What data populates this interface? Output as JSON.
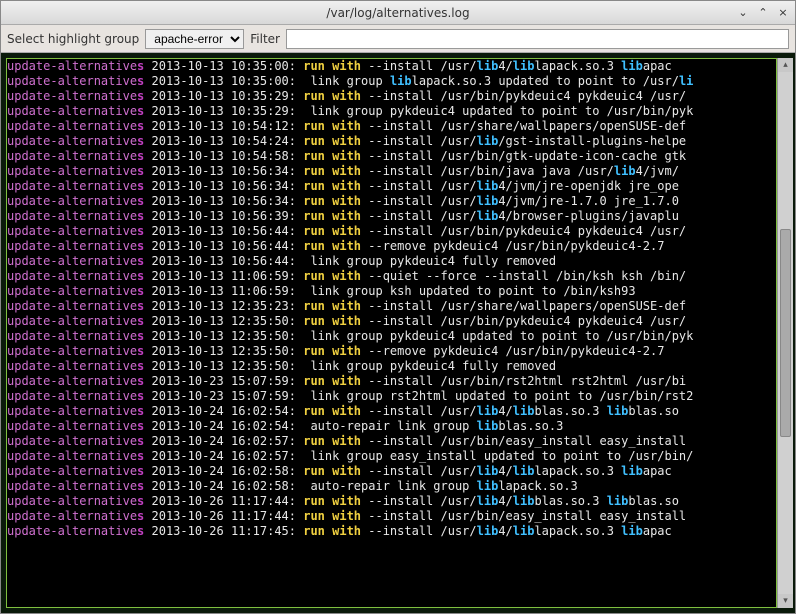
{
  "window": {
    "title": "/var/log/alternatives.log",
    "buttons": {
      "min": "⌄",
      "max": "⌃",
      "close": "×"
    }
  },
  "toolbar": {
    "highlight_label": "Select highlight group",
    "highlight_value": "apache-error",
    "filter_label": "Filter",
    "filter_value": ""
  },
  "colors": {
    "bg_terminal": "#000000",
    "border_terminal": "#7fbf3f",
    "purple": "#d070d0",
    "purple_bold": "#c040c0",
    "white": "#e8e8e8",
    "yellow": "#f0d040",
    "cyan": "#40c0ff"
  },
  "log_lines": [
    {
      "ts": "2013-10-13 10:35:00:",
      "action": "run with",
      "rest": " --install /usr/",
      "h": "lib",
      "r2": "4/",
      "h2": "lib",
      "r3": "lapack.so.3 ",
      "h3": "lib",
      "r4": "apac"
    },
    {
      "ts": "2013-10-13 10:35:00:",
      "action": "",
      "rest": " link group ",
      "h": "lib",
      "r2": "lapack.so.3 updated to point to /usr/",
      "h2": "li"
    },
    {
      "ts": "2013-10-13 10:35:29:",
      "action": "run with",
      "rest": " --install /usr/bin/pykdeuic4 pykdeuic4 /usr/"
    },
    {
      "ts": "2013-10-13 10:35:29:",
      "action": "",
      "rest": " link group pykdeuic4 updated to point to /usr/bin/pyk"
    },
    {
      "ts": "2013-10-13 10:54:12:",
      "action": "run with",
      "rest": " --install /usr/share/wallpapers/openSUSE-def"
    },
    {
      "ts": "2013-10-13 10:54:24:",
      "action": "run with",
      "rest": " --install /usr/",
      "h": "lib",
      "r2": "/gst-install-plugins-helpe"
    },
    {
      "ts": "2013-10-13 10:54:58:",
      "action": "run with",
      "rest": " --install /usr/bin/gtk-update-icon-cache gtk"
    },
    {
      "ts": "2013-10-13 10:56:34:",
      "action": "run with",
      "rest": " --install /usr/bin/java java /usr/",
      "h": "lib",
      "r2": "4/jvm/"
    },
    {
      "ts": "2013-10-13 10:56:34:",
      "action": "run with",
      "rest": " --install /usr/",
      "h": "lib",
      "r2": "4/jvm/jre-openjdk jre_ope"
    },
    {
      "ts": "2013-10-13 10:56:34:",
      "action": "run with",
      "rest": " --install /usr/",
      "h": "lib",
      "r2": "4/jvm/jre-1.7.0 jre_1.7.0"
    },
    {
      "ts": "2013-10-13 10:56:39:",
      "action": "run with",
      "rest": " --install /usr/",
      "h": "lib",
      "r2": "4/browser-plugins/javaplu"
    },
    {
      "ts": "2013-10-13 10:56:44:",
      "action": "run with",
      "rest": " --install /usr/bin/pykdeuic4 pykdeuic4 /usr/"
    },
    {
      "ts": "2013-10-13 10:56:44:",
      "action": "run with",
      "rest": " --remove pykdeuic4 /usr/bin/pykdeuic4-2.7"
    },
    {
      "ts": "2013-10-13 10:56:44:",
      "action": "",
      "rest": " link group pykdeuic4 fully removed"
    },
    {
      "ts": "2013-10-13 11:06:59:",
      "action": "run with",
      "rest": " --quiet --force --install /bin/ksh ksh /bin/"
    },
    {
      "ts": "2013-10-13 11:06:59:",
      "action": "",
      "rest": " link group ksh updated to point to /bin/ksh93"
    },
    {
      "ts": "2013-10-13 12:35:23:",
      "action": "run with",
      "rest": " --install /usr/share/wallpapers/openSUSE-def"
    },
    {
      "ts": "2013-10-13 12:35:50:",
      "action": "run with",
      "rest": " --install /usr/bin/pykdeuic4 pykdeuic4 /usr/"
    },
    {
      "ts": "2013-10-13 12:35:50:",
      "action": "",
      "rest": " link group pykdeuic4 updated to point to /usr/bin/pyk"
    },
    {
      "ts": "2013-10-13 12:35:50:",
      "action": "run with",
      "rest": " --remove pykdeuic4 /usr/bin/pykdeuic4-2.7"
    },
    {
      "ts": "2013-10-13 12:35:50:",
      "action": "",
      "rest": " link group pykdeuic4 fully removed"
    },
    {
      "ts": "2013-10-23 15:07:59:",
      "action": "run with",
      "rest": " --install /usr/bin/rst2html rst2html /usr/bi"
    },
    {
      "ts": "2013-10-23 15:07:59:",
      "action": "",
      "rest": " link group rst2html updated to point to /usr/bin/rst2"
    },
    {
      "ts": "2013-10-24 16:02:54:",
      "action": "run with",
      "rest": " --install /usr/",
      "h": "lib",
      "r2": "4/",
      "h2": "lib",
      "r3": "blas.so.3 ",
      "h3": "lib",
      "r4": "blas.so"
    },
    {
      "ts": "2013-10-24 16:02:54:",
      "action": "",
      "rest": " auto-repair link group ",
      "h": "lib",
      "r2": "blas.so.3"
    },
    {
      "ts": "2013-10-24 16:02:57:",
      "action": "run with",
      "rest": " --install /usr/bin/easy_install easy_install"
    },
    {
      "ts": "2013-10-24 16:02:57:",
      "action": "",
      "rest": " link group easy_install updated to point to /usr/bin/"
    },
    {
      "ts": "2013-10-24 16:02:58:",
      "action": "run with",
      "rest": " --install /usr/",
      "h": "lib",
      "r2": "4/",
      "h2": "lib",
      "r3": "lapack.so.3 ",
      "h3": "lib",
      "r4": "apac"
    },
    {
      "ts": "2013-10-24 16:02:58:",
      "action": "",
      "rest": " auto-repair link group ",
      "h": "lib",
      "r2": "lapack.so.3"
    },
    {
      "ts": "2013-10-26 11:17:44:",
      "action": "run with",
      "rest": " --install /usr/",
      "h": "lib",
      "r2": "4/",
      "h2": "lib",
      "r3": "blas.so.3 ",
      "h3": "lib",
      "r4": "blas.so"
    },
    {
      "ts": "2013-10-26 11:17:44:",
      "action": "run with",
      "rest": " --install /usr/bin/easy_install easy_install"
    },
    {
      "ts": "2013-10-26 11:17:45:",
      "action": "run with",
      "rest": " --install /usr/",
      "h": "lib",
      "r2": "4/",
      "h2": "lib",
      "r3": "lapack.so.3 ",
      "h3": "lib",
      "r4": "apac"
    }
  ],
  "prefix": {
    "part1": "update-alternative",
    "part2": "s "
  }
}
